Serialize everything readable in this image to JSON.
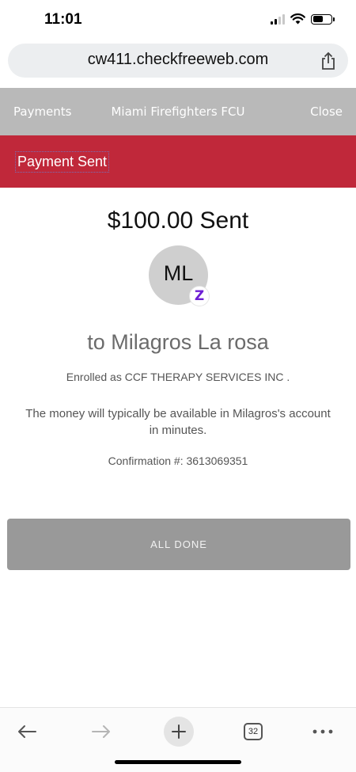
{
  "status_bar": {
    "time": "11:01",
    "icons": [
      "cellular-signal-icon",
      "wifi-icon",
      "battery-icon"
    ]
  },
  "browser": {
    "url": "cw411.checkfreeweb.com",
    "share_icon": "share-icon",
    "toolbar": {
      "back_icon": "back-arrow-icon",
      "forward_icon": "forward-arrow-icon",
      "new_tab_icon": "plus-icon",
      "tab_count": "32",
      "more_icon": "more-icon"
    }
  },
  "nav": {
    "payments": "Payments",
    "institution": "Miami Firefighters FCU",
    "close": "Close"
  },
  "banner": {
    "title": "Payment Sent",
    "color": "#c0283a"
  },
  "receipt": {
    "amount": "$100.00 Sent",
    "avatar_initials": "ML",
    "zelle_badge": "Z",
    "recipient": "to Milagros La rosa",
    "enrolled": "Enrolled as CCF THERAPY SERVICES INC .",
    "availability": "The money will typically be available in Milagros's account in minutes.",
    "confirmation": "Confirmation #: 3613069351"
  },
  "actions": {
    "done": "ALL DONE"
  },
  "colors": {
    "nav_bg": "#b9b9b9",
    "button_bg": "#999999",
    "zelle_purple": "#6d1ed4"
  }
}
